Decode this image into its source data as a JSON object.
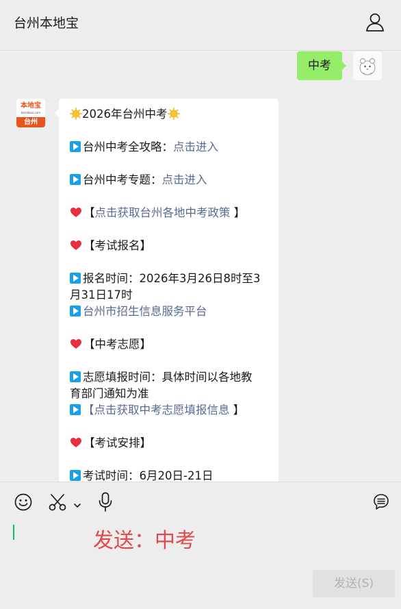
{
  "header": {
    "title": "台州本地宝"
  },
  "sent_message": {
    "text": "中考"
  },
  "bot_avatar": {
    "logo_text": "本地宝",
    "logo_sub": "bendibao.com",
    "city": "台州"
  },
  "reply": {
    "title": "2026年台州中考",
    "guide_label": "台州中考全攻略：",
    "guide_link": "点击进入",
    "topic_label": "台州中考专题：",
    "topic_link": "点击进入",
    "policy_open": "【",
    "policy_link": "点击获取台州各地中考政策",
    "policy_close": " 】",
    "section_register": "【考试报名】",
    "register_time_1": "报名时间：2026年3月26日8时至3",
    "register_time_2": "月31日17时",
    "register_platform": "台州市招生信息服务平台",
    "section_wish": "【中考志愿】",
    "wish_time_1": "志愿填报时间：具体时间以各地教",
    "wish_time_2": "育部门通知为准",
    "wish_open": "【",
    "wish_link": "点击获取中考志愿填报信息",
    "wish_close": " 】",
    "section_exam": "【考试安排】",
    "exam_time": "考试时间：6月20日-21日"
  },
  "input": {
    "text": "发送：中考"
  },
  "send_button": {
    "label": "发送(S)"
  },
  "icons": [
    "user-icon",
    "emoji-icon",
    "scissors-icon",
    "chevron-down-icon",
    "microphone-icon",
    "chat-history-icon",
    "sun-emoji-icon",
    "play-emoji-icon",
    "heart-emoji-icon"
  ],
  "colors": {
    "sent_bubble": "#95ec69",
    "link": "#576b95",
    "input_text": "#e04a4a",
    "play_icon": "#1aa0e6",
    "heart": "#e8303f",
    "brand": "#e8541c"
  }
}
